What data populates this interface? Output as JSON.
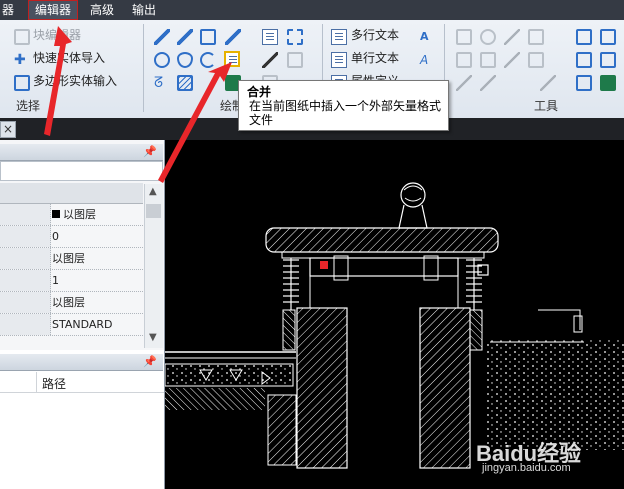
{
  "menu": {
    "items": [
      {
        "label": "器",
        "active": false
      },
      {
        "label": "编辑器",
        "active": true
      },
      {
        "label": "高级",
        "active": false
      },
      {
        "label": "输出",
        "active": false
      }
    ]
  },
  "ribbon": {
    "select_group": {
      "label": "选择",
      "buttons": [
        "块编辑器",
        "快速实体导入",
        "多边形实体输入"
      ]
    },
    "draw_group": {
      "label": "绘制"
    },
    "text_group": {
      "buttons": [
        "多行文本",
        "单行文本",
        "属性定义"
      ]
    },
    "tools_group": {
      "label": "工具"
    }
  },
  "tooltip": {
    "title": "合并",
    "description": "在当前图纸中插入一个外部矢量格式文件"
  },
  "properties_panel": {
    "rows": [
      {
        "value": "以图层",
        "swatch": "#000000"
      },
      {
        "value": "0"
      },
      {
        "value": "以图层"
      },
      {
        "value": "1"
      },
      {
        "value": "以图层"
      },
      {
        "value": "STANDARD"
      }
    ]
  },
  "layers_panel": {
    "column_header": "路径"
  },
  "watermark": {
    "brand": "Baidu经验",
    "url": "jingyan.baidu.com"
  },
  "colors": {
    "annotation_arrow": "#e8262a",
    "accent_blue": "#2f6fc7",
    "canvas_bg": "#000000",
    "drawing_lines": "#ffffff"
  }
}
